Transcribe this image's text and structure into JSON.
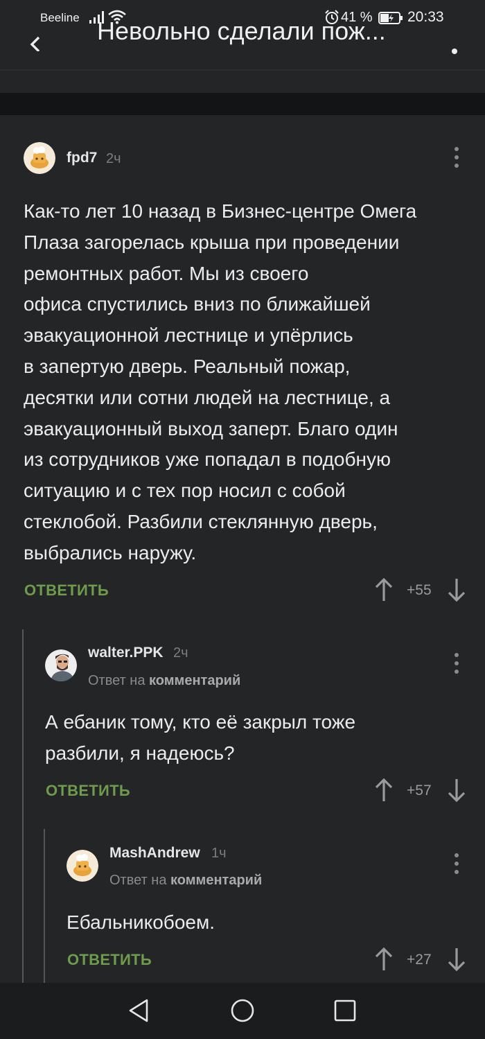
{
  "status_bar": {
    "carrier": "Beeline",
    "battery_percent": "41 %",
    "time": "20:33"
  },
  "header": {
    "title": "Невольно сделали пож..."
  },
  "comments": [
    {
      "author": "fpd7",
      "time": "2ч",
      "text_lines": [
        "Как-то лет 10 назад в Бизнес-центре Омега",
        "Плаза загорелась крыша при проведении",
        "ремонтных работ. Мы из своего",
        "офиса спустились вниз по ближайшей",
        "эвакуационной лестнице и упёрлись",
        "в запертую дверь. Реальный пожар,",
        "десятки или сотни людей на лестнице, а",
        "эвакуационный выход заперт. Благо один",
        "из сотрудников уже попадал в подобную",
        "ситуацию и с тех пор носил с собой",
        "стеклобой. Разбили стеклянную дверь,",
        "выбрались наружу."
      ],
      "reply_label": "ОТВЕТИТЬ",
      "score": "+55"
    },
    {
      "author": "walter.PPK",
      "time": "2ч",
      "reply_prefix": "Ответ на",
      "reply_target": "комментарий",
      "text_lines": [
        "А ебаник тому, кто её закрыл тоже",
        "разбили, я надеюсь?"
      ],
      "reply_label": "ОТВЕТИТЬ",
      "score": "+57"
    },
    {
      "author": "MashAndrew",
      "time": "1ч",
      "reply_prefix": "Ответ на",
      "reply_target": "комментарий",
      "text_lines": [
        "Ебальникобоем."
      ],
      "reply_label": "ОТВЕТИТЬ",
      "score": "+27"
    }
  ],
  "colors": {
    "background": "#242527",
    "accent_green": "#6e9c4c",
    "text": "#ececec",
    "muted": "#7c7d80"
  },
  "icons": [
    "signal-icon",
    "wifi-icon",
    "alarm-icon",
    "battery-icon",
    "back-arrow-icon",
    "more-vertical-icon",
    "upvote-arrow-icon",
    "downvote-arrow-icon",
    "nav-back-icon",
    "nav-home-icon",
    "nav-recents-icon"
  ]
}
